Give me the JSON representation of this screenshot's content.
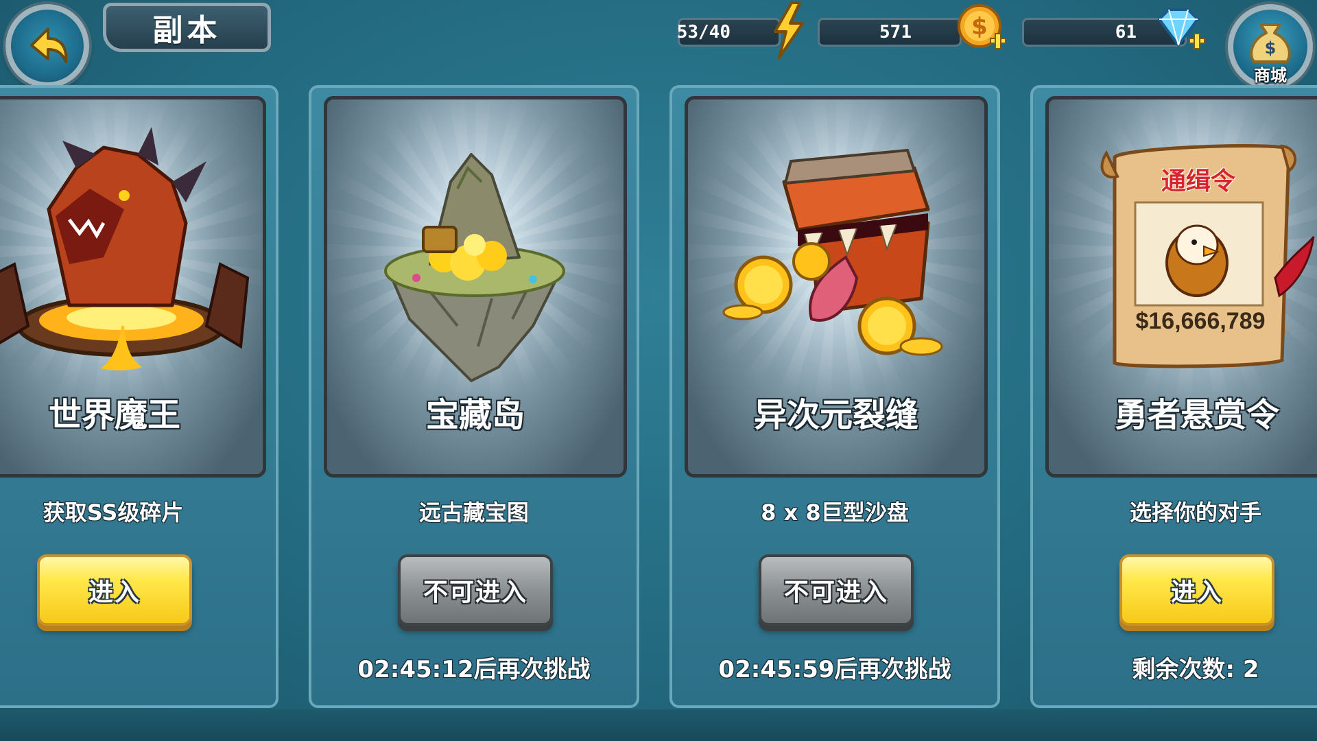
{
  "header": {
    "title": "副本",
    "energy": "53/40",
    "gold": "571",
    "gems": "61",
    "shop_label": "商城"
  },
  "cards": [
    {
      "title": "世界魔王",
      "subtitle": "获取SS级碎片",
      "button": "进入",
      "note": ""
    },
    {
      "title": "宝藏岛",
      "subtitle": "远古藏宝图",
      "button": "不可进入",
      "note": "02:45:12后再次挑战"
    },
    {
      "title": "异次元裂缝",
      "subtitle": "8 x 8巨型沙盘",
      "button": "不可进入",
      "note": "02:45:59后再次挑战"
    },
    {
      "title": "勇者悬赏令",
      "subtitle": "选择你的对手",
      "button": "进入",
      "note": "剩余次数: 2",
      "poster_title": "通缉令",
      "poster_reward": "$16,666,789"
    }
  ],
  "colors": {
    "background": "#2a7188",
    "enter_button": "#ffe84a",
    "disabled_button": "#8c9194"
  }
}
